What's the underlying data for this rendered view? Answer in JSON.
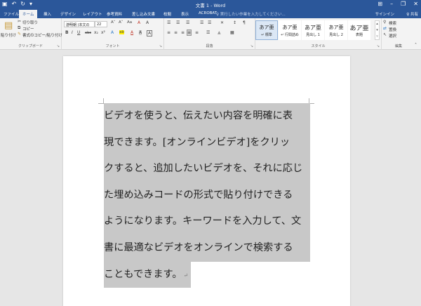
{
  "window": {
    "title": "文書 1 - Word",
    "controls": [
      "⊞",
      "–",
      "❐",
      "✕"
    ]
  },
  "quick_access": {
    "save_icon": "▣",
    "undo_icon": "↶",
    "redo_icon": "↻",
    "more_icon": "▾"
  },
  "tabs": [
    "ファイル",
    "ホーム",
    "挿入",
    "デザイン",
    "レイアウト",
    "参考資料",
    "差し込み文書",
    "校閲",
    "表示",
    "ACROBAT"
  ],
  "active_tab": "ホーム",
  "tell_me": "♀ 実行したい作業を入力してください...",
  "signin": "サインイン",
  "share": "♀ 共有",
  "clipboard": {
    "paste": "貼り付け",
    "cut": "切り取り",
    "copy": "コピー",
    "format_painter": "書式のコピー/貼り付け",
    "label": "クリップボード"
  },
  "font": {
    "font_name": "游明朝 (本文の",
    "font_size": "22",
    "label": "フォント",
    "row1_icons": [
      "A˄",
      "A˅",
      "Aa",
      "A",
      "A"
    ],
    "row2_icons": [
      "B",
      "I",
      "U",
      "abc",
      "x₂",
      "x²",
      "A",
      "ab",
      "A",
      "A",
      "A"
    ]
  },
  "paragraph": {
    "label": "段落",
    "row1_icons": [
      "☰",
      "☰",
      "☰",
      "☰",
      "☰",
      "✕",
      "↕",
      "¶"
    ],
    "row2_icons": [
      "≡",
      "≡",
      "≡",
      "≡",
      "≡",
      "☰",
      "▲",
      "▦"
    ]
  },
  "styles": {
    "label": "スタイル",
    "items": [
      {
        "sample": "あア亜",
        "name": "↵ 標準"
      },
      {
        "sample": "あア亜",
        "name": "↵ 行間詰め"
      },
      {
        "sample": "あア亜",
        "name": "見出し 1"
      },
      {
        "sample": "あア亜",
        "name": "見出し 2"
      },
      {
        "sample": "あア亜",
        "name": "表題"
      }
    ],
    "scroll_up": "▴",
    "scroll_down": "▾",
    "more": "▿"
  },
  "editing": {
    "find": "検索",
    "replace": "置換",
    "select": "選択",
    "label": "編集"
  },
  "document": {
    "lines": [
      "ビデオを使うと、伝えたい内容を明確に表",
      "現できます。[オンラインビデオ]をクリッ",
      "クすると、追加したいビデオを、それに応じ",
      "た埋め込みコードの形式で貼り付けできる",
      "ようになります。キーワードを入力して、文",
      "書に最適なビデオをオンラインで検索する",
      "こともできます。"
    ],
    "paragraph_mark": "↵"
  }
}
